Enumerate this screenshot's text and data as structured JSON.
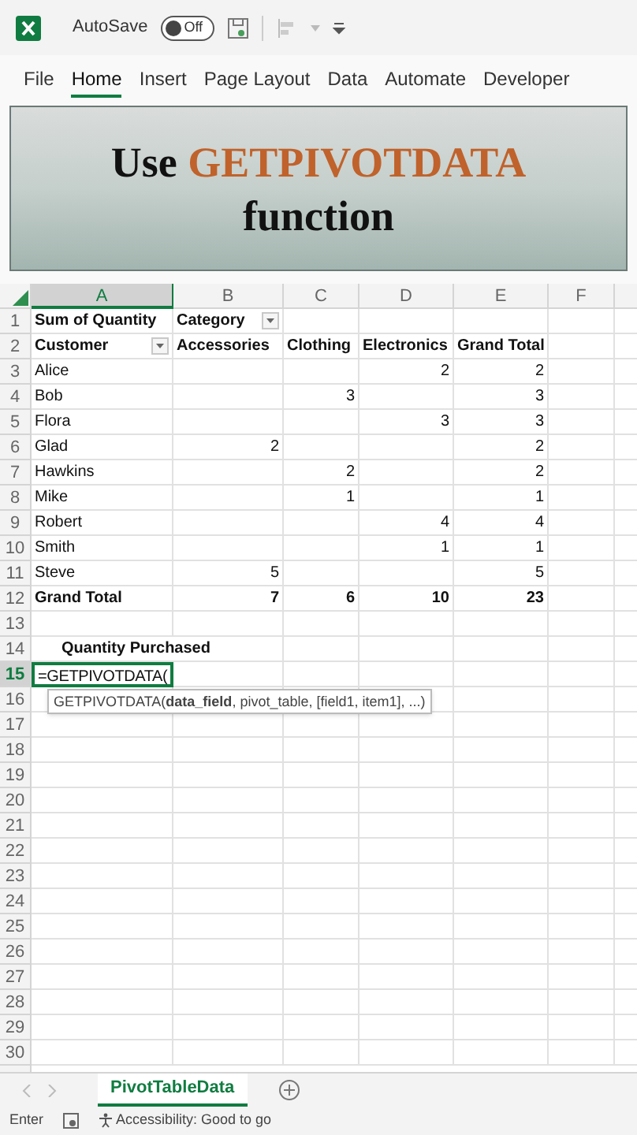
{
  "title_bar": {
    "autosave_label": "AutoSave",
    "autosave": {
      "on": false,
      "label": "Off"
    }
  },
  "ribbon_tabs": [
    {
      "label": "File",
      "selected": false
    },
    {
      "label": "Home",
      "selected": true
    },
    {
      "label": "Insert",
      "selected": false
    },
    {
      "label": "Page Layout",
      "selected": false
    },
    {
      "label": "Data",
      "selected": false
    },
    {
      "label": "Automate",
      "selected": false
    },
    {
      "label": "Developer",
      "selected": false
    }
  ],
  "banner": {
    "lead": "Use",
    "highlight": "GETPIVOTDATA",
    "trail": "function"
  },
  "columns": [
    {
      "label": "A",
      "selected": true
    },
    {
      "label": "B",
      "selected": false
    },
    {
      "label": "C",
      "selected": false
    },
    {
      "label": "D",
      "selected": false
    },
    {
      "label": "E",
      "selected": false
    },
    {
      "label": "F",
      "selected": false
    }
  ],
  "rows": [
    {
      "number": "1",
      "kind": "header",
      "selected": false,
      "cells": {
        "A": "Sum of Quantity",
        "B": {
          "text": "Category",
          "filter": true
        }
      }
    },
    {
      "number": "2",
      "kind": "header",
      "selected": false,
      "cells": {
        "A": {
          "text": "Customer",
          "filter": true
        },
        "B": "Accessories",
        "C": "Clothing",
        "D": "Electronics",
        "E": "Grand Total"
      }
    },
    {
      "number": "3",
      "kind": "data",
      "selected": false,
      "cells": {
        "A": "Alice",
        "D": "2",
        "E": "2"
      }
    },
    {
      "number": "4",
      "kind": "data",
      "selected": false,
      "cells": {
        "A": "Bob",
        "C": "3",
        "E": "3"
      }
    },
    {
      "number": "5",
      "kind": "data",
      "selected": false,
      "cells": {
        "A": "Flora",
        "D": "3",
        "E": "3"
      }
    },
    {
      "number": "6",
      "kind": "data",
      "selected": false,
      "cells": {
        "A": "Glad",
        "B": "2",
        "E": "2"
      }
    },
    {
      "number": "7",
      "kind": "data",
      "selected": false,
      "cells": {
        "A": "Hawkins",
        "C": "2",
        "E": "2"
      }
    },
    {
      "number": "8",
      "kind": "data",
      "selected": false,
      "cells": {
        "A": "Mike",
        "C": "1",
        "E": "1"
      }
    },
    {
      "number": "9",
      "kind": "data",
      "selected": false,
      "cells": {
        "A": "Robert",
        "D": "4",
        "E": "4"
      }
    },
    {
      "number": "10",
      "kind": "data",
      "selected": false,
      "cells": {
        "A": "Smith",
        "D": "1",
        "E": "1"
      }
    },
    {
      "number": "11",
      "kind": "data",
      "selected": false,
      "cells": {
        "A": "Steve",
        "B": "5",
        "E": "5"
      }
    },
    {
      "number": "12",
      "kind": "total",
      "selected": false,
      "cells": {
        "A": "Grand Total",
        "B": "7",
        "C": "6",
        "D": "10",
        "E": "23"
      }
    },
    {
      "number": "13",
      "kind": "empty",
      "selected": false
    },
    {
      "number": "14",
      "kind": "label",
      "selected": false,
      "cells": {
        "A": "Quantity Purchased"
      }
    },
    {
      "number": "15",
      "kind": "edit",
      "selected": true,
      "cells": {
        "A": "=GETPIVOTDATA("
      }
    },
    {
      "number": "16",
      "kind": "empty",
      "selected": false
    },
    {
      "number": "17",
      "kind": "empty",
      "selected": false
    },
    {
      "number": "18",
      "kind": "empty",
      "selected": false
    },
    {
      "number": "19",
      "kind": "empty",
      "selected": false
    },
    {
      "number": "20",
      "kind": "empty",
      "selected": false
    },
    {
      "number": "21",
      "kind": "empty",
      "selected": false
    },
    {
      "number": "22",
      "kind": "empty",
      "selected": false
    },
    {
      "number": "23",
      "kind": "empty",
      "selected": false
    },
    {
      "number": "24",
      "kind": "empty",
      "selected": false
    },
    {
      "number": "25",
      "kind": "empty",
      "selected": false
    },
    {
      "number": "26",
      "kind": "empty",
      "selected": false
    },
    {
      "number": "27",
      "kind": "empty",
      "selected": false
    },
    {
      "number": "28",
      "kind": "empty",
      "selected": false
    },
    {
      "number": "29",
      "kind": "empty",
      "selected": false
    },
    {
      "number": "30",
      "kind": "empty",
      "selected": false
    }
  ],
  "formula_tooltip": "GETPIVOTDATA(**data_field**, pivot_table, [field1, item1], ...)",
  "sheet_tabs": [
    {
      "label": "PivotTableData",
      "selected": true
    }
  ],
  "status_bar": {
    "mode": "Enter",
    "accessibility": "Accessibility: Good to go"
  }
}
